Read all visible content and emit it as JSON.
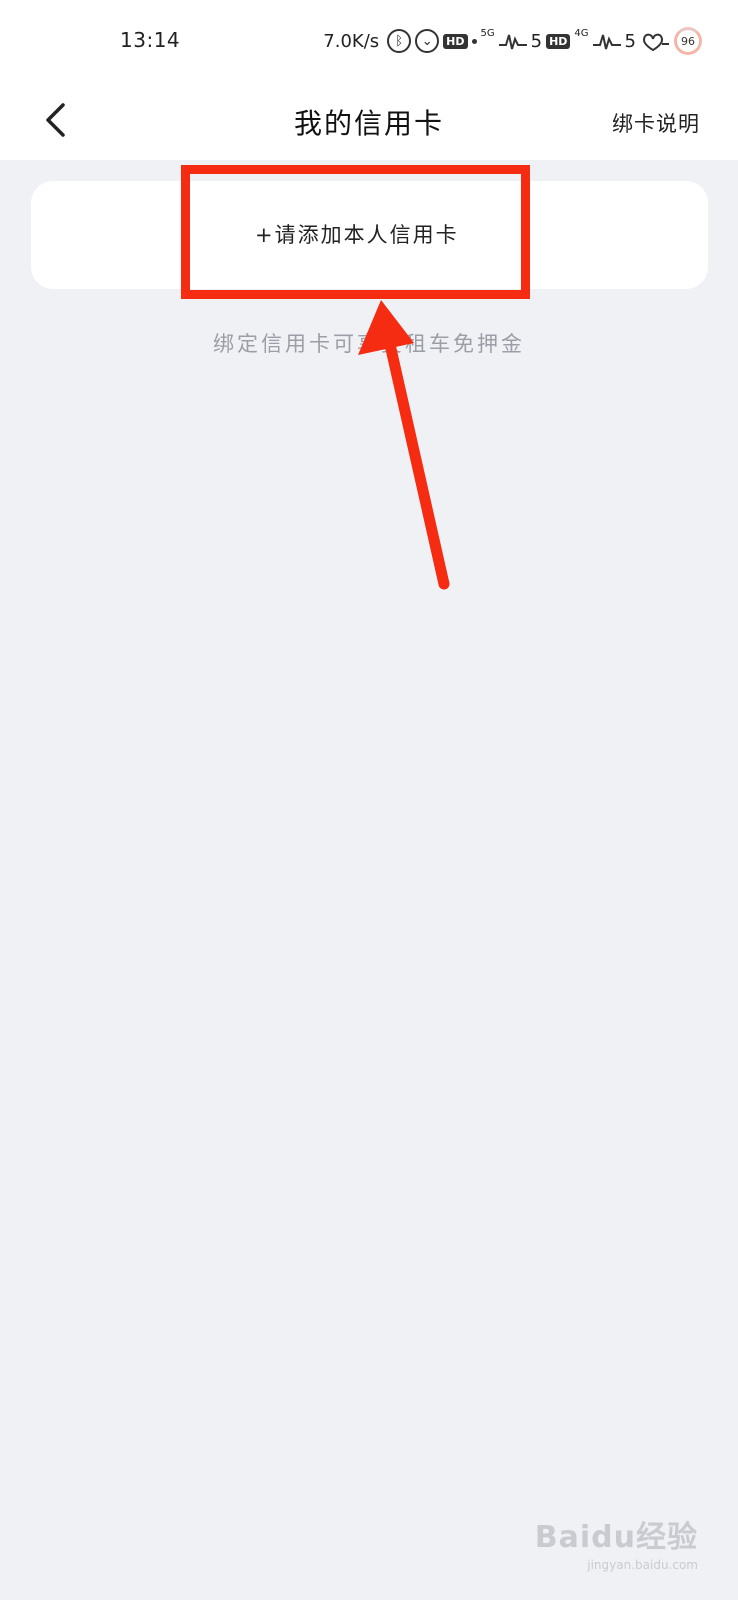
{
  "status_bar": {
    "time": "13:14",
    "net_speed": "7.0K/s",
    "bluetooth_icon": "bluetooth-icon",
    "alarm_icon": "alarm-icon",
    "hd_1": "HD",
    "net_5g": "5G",
    "signal_1_level": "5",
    "hd_2": "HD",
    "net_4g": "4G",
    "signal_2_level": "5",
    "battery": "96"
  },
  "nav": {
    "title": "我的信用卡",
    "back_icon": "chevron-left-icon",
    "right_link": "绑卡说明"
  },
  "add_card": {
    "label": "+请添加本人信用卡"
  },
  "hint": "绑定信用卡可享受租车免押金",
  "annotation": {
    "color": "#f52b12"
  },
  "watermark": {
    "brand": "Baidu经验",
    "url": "jingyan.baidu.com"
  },
  "colors": {
    "background": "#f0f1f5",
    "surface": "#ffffff",
    "hint": "#9b9ea6"
  }
}
